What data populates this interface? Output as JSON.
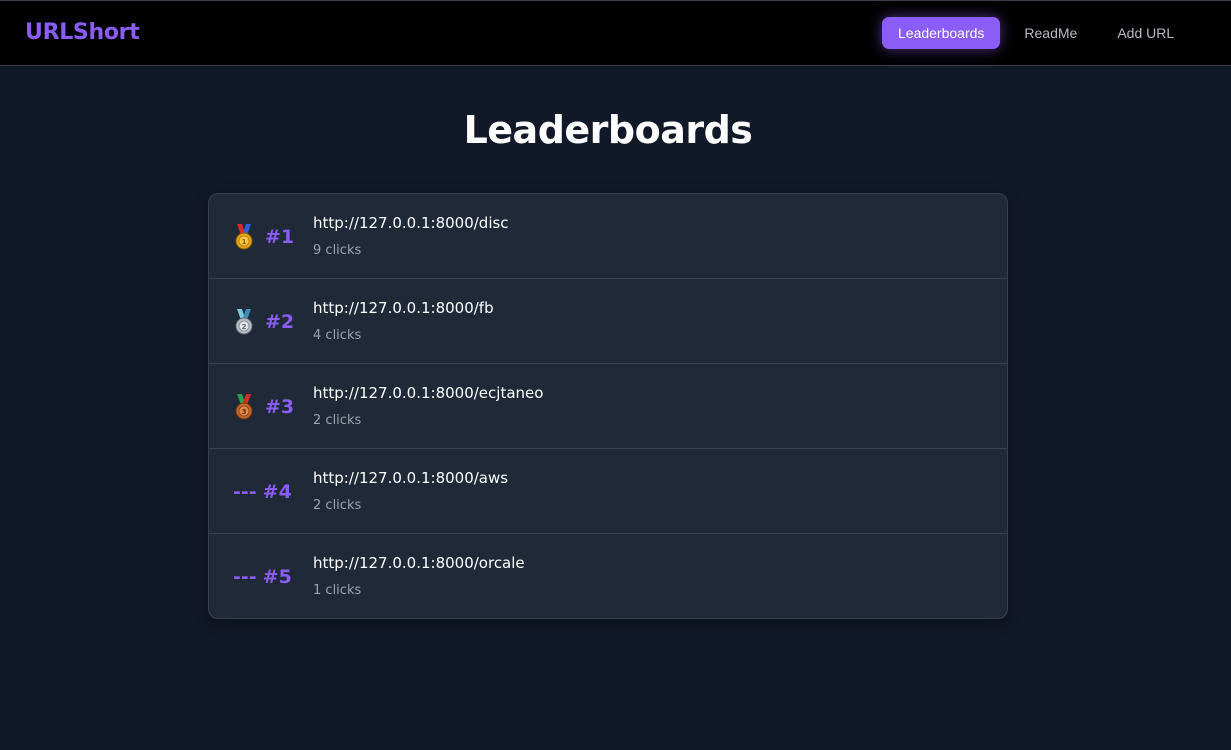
{
  "nav": {
    "brand": "URLShort",
    "links": [
      {
        "label": "Leaderboards",
        "active": true
      },
      {
        "label": "ReadMe",
        "active": false
      },
      {
        "label": "Add URL",
        "active": false
      }
    ]
  },
  "main": {
    "title": "Leaderboards",
    "rows": [
      {
        "medal": "gold-medal-icon",
        "rank": "#1",
        "url": "http://127.0.0.1:8000/disc",
        "clicks": "9",
        "clicks_suffix": "clicks"
      },
      {
        "medal": "silver-medal-icon",
        "rank": "#2",
        "url": "http://127.0.0.1:8000/fb",
        "clicks": "4",
        "clicks_suffix": "clicks"
      },
      {
        "medal": "bronze-medal-icon",
        "rank": "#3",
        "url": "http://127.0.0.1:8000/ecjtaneo",
        "clicks": "2",
        "clicks_suffix": "clicks"
      },
      {
        "prefix": "---",
        "rank": "#4",
        "url": "http://127.0.0.1:8000/aws",
        "clicks": "2",
        "clicks_suffix": "clicks"
      },
      {
        "prefix": "---",
        "rank": "#5",
        "url": "http://127.0.0.1:8000/orcale",
        "clicks": "1",
        "clicks_suffix": "clicks"
      }
    ]
  },
  "colors": {
    "accent": "#8b5cf6",
    "background": "#111827",
    "card": "#1f2937",
    "navbar": "#000000"
  }
}
